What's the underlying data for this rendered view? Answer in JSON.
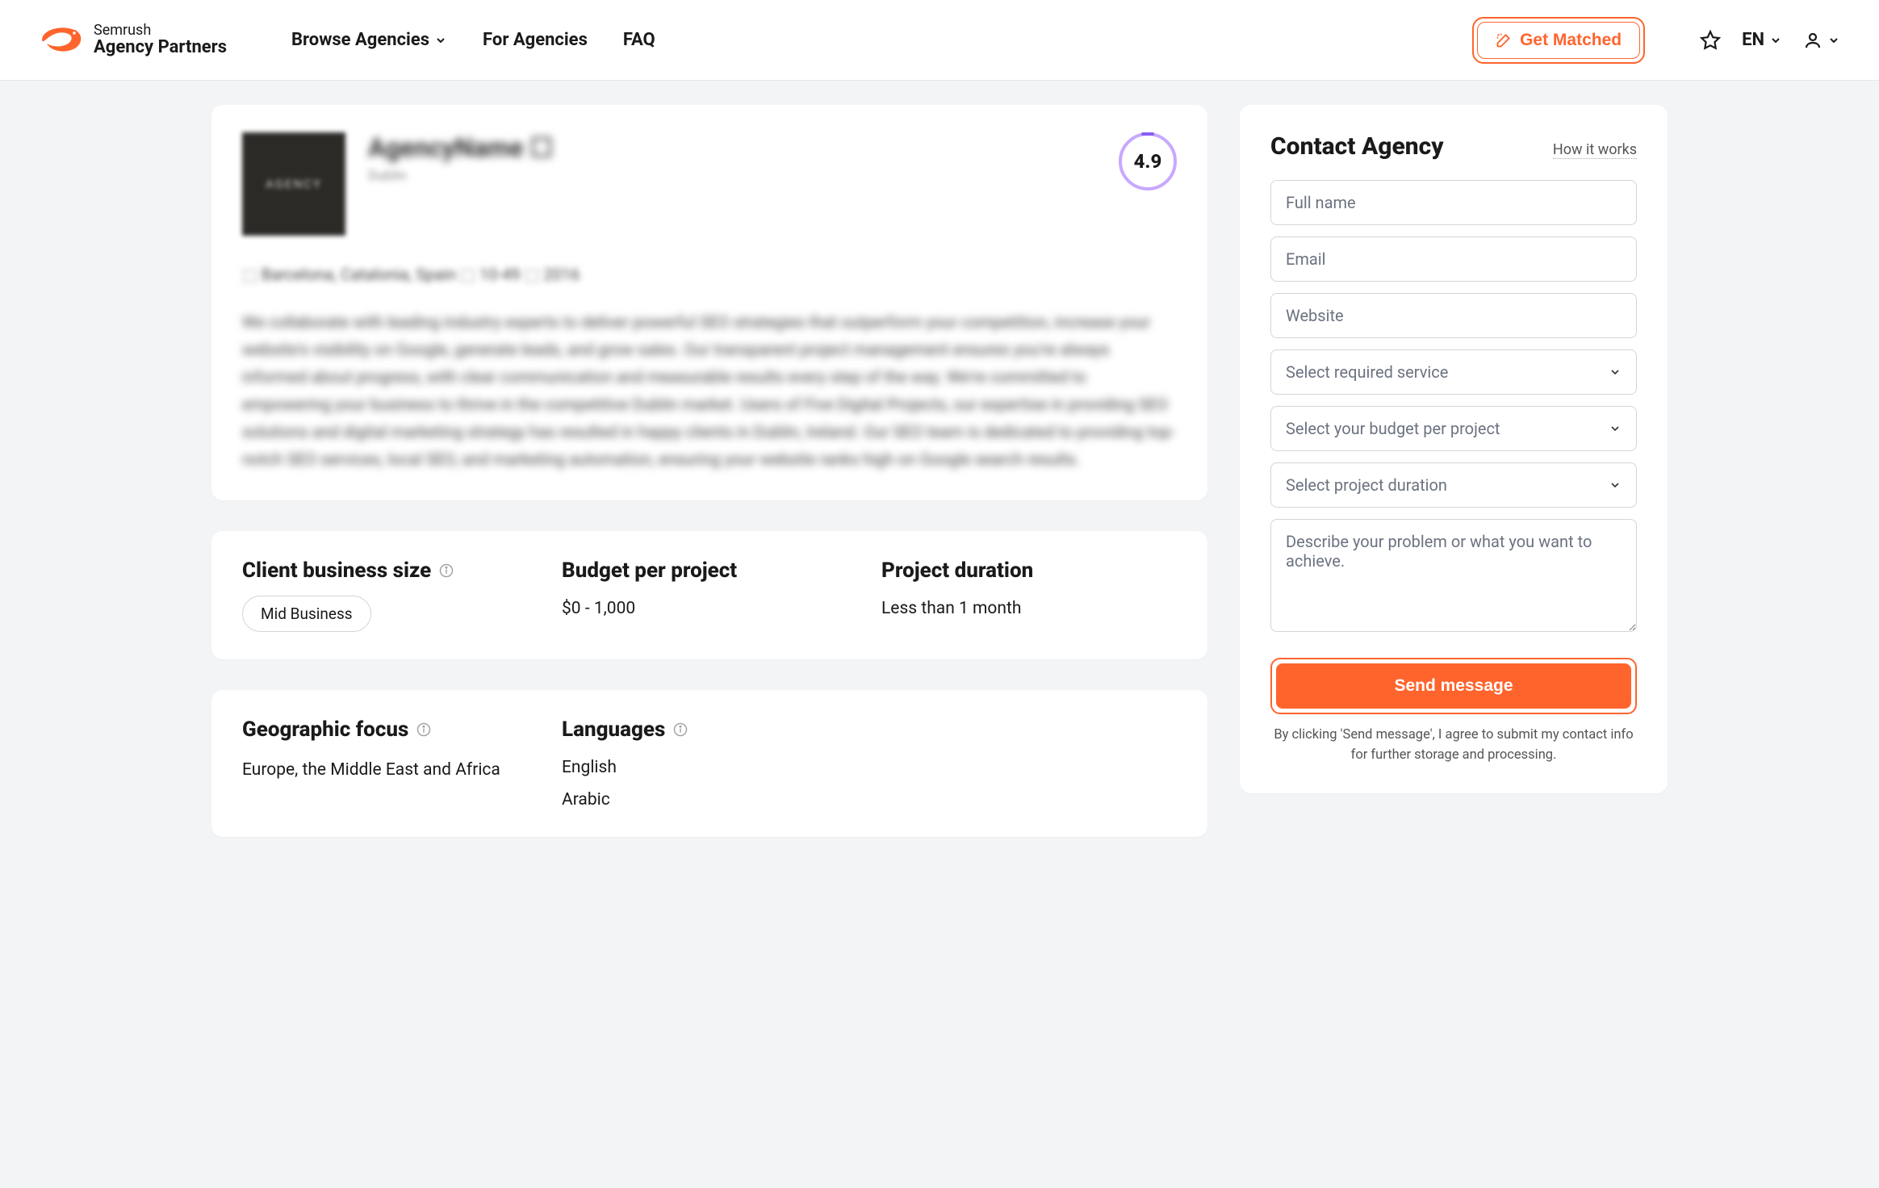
{
  "header": {
    "logo_top": "Semrush",
    "logo_bottom": "Agency Partners",
    "nav": {
      "browse": "Browse Agencies",
      "for_agencies": "For Agencies",
      "faq": "FAQ"
    },
    "get_matched": "Get Matched",
    "lang": "EN"
  },
  "profile": {
    "agency_logo_text": "AGENCY",
    "agency_name": "AgencyName ☐",
    "agency_sub": "Dublin",
    "rating": "4.9",
    "meta": "⬚  Barcelona, Catalonia, Spain    ⬚ 10-49   ⬚ 2016",
    "description": "We collaborate with leading industry experts to deliver powerful SEO strategies that outperform your competition, increase your website's visibility on Google, generate leads, and grow sales. Our transparent project management ensures you're always informed about progress, with clear communication and measurable results every step of the way. We're committed to empowering your business to thrive in the competitive Dublin market. Users of Five Digital Projects, our expertise in providing SEO solutions and digital marketing strategy has resulted in happy clients in Dublin, Ireland. Our SEO team is dedicated to providing top-notch SEO services, local SEO, and marketing automation, ensuring your website ranks high on Google search results."
  },
  "details": {
    "size_title": "Client business size",
    "size_pill": "Mid Business",
    "budget_title": "Budget per project",
    "budget_value": "$0 - 1,000",
    "duration_title": "Project duration",
    "duration_value": "Less than 1 month"
  },
  "geo": {
    "geo_title": "Geographic focus",
    "geo_value": "Europe, the Middle East and Africa",
    "lang_title": "Languages",
    "languages": [
      "English",
      "Arabic"
    ]
  },
  "contact": {
    "title": "Contact Agency",
    "how_link": "How it works",
    "full_name_ph": "Full name",
    "email_ph": "Email",
    "website_ph": "Website",
    "service_ph": "Select required service",
    "budget_ph": "Select your budget per project",
    "duration_ph": "Select project duration",
    "describe_ph": "Describe your problem or what you want to achieve.",
    "send_label": "Send message",
    "disclaimer": "By clicking 'Send message', I agree to submit my contact info for further storage and processing."
  }
}
